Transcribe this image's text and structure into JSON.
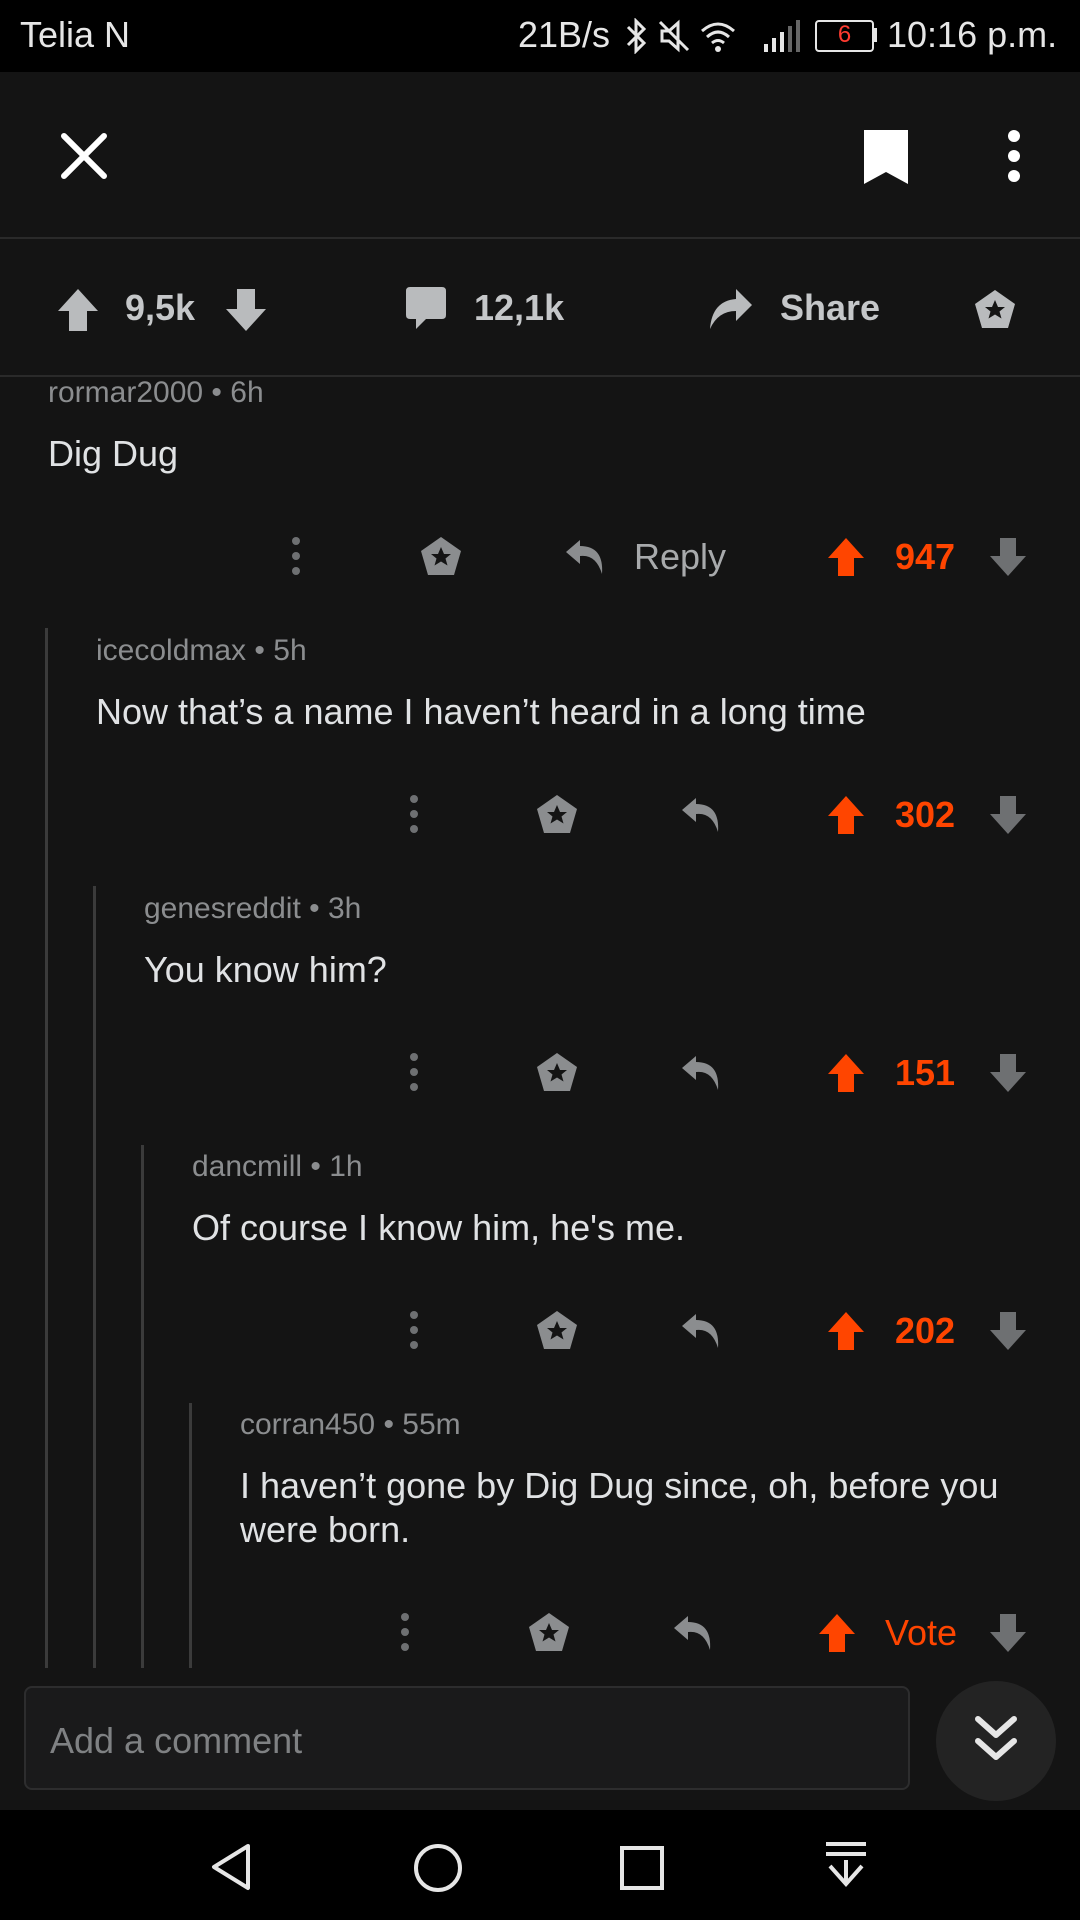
{
  "status_bar": {
    "carrier": "Telia N",
    "net_speed": "21B/s",
    "battery": "6",
    "time": "10:16 p.m."
  },
  "post_actions": {
    "upvotes": "9,5k",
    "comments": "12,1k",
    "share_label": "Share"
  },
  "comments": [
    {
      "author": "rormar2000",
      "age": "6h",
      "text": "Dig Dug",
      "score": "947",
      "reply_label": "Reply"
    },
    {
      "author": "icecoldmax",
      "age": "5h",
      "text": "Now that’s a name I haven’t heard in a long time",
      "score": "302"
    },
    {
      "author": "genesreddit",
      "age": "3h",
      "text": "You know him?",
      "score": "151"
    },
    {
      "author": "dancmill",
      "age": "1h",
      "text": "Of course I know him, he's me.",
      "score": "202"
    },
    {
      "author": "corran450",
      "age": "55m",
      "text_line1": "I haven’t gone by Dig Dug since, oh, before you",
      "text_line2": "were born.",
      "score": "Vote"
    }
  ],
  "comment_input": {
    "placeholder": "Add a comment"
  },
  "meta_separator": "•",
  "colors": {
    "upvote": "#ff4500",
    "background": "#141414",
    "muted": "#8b8d8f"
  },
  "icons": [
    "close-icon",
    "bookmark-icon",
    "more-vertical-icon",
    "upvote-icon",
    "downvote-icon",
    "comment-icon",
    "share-icon",
    "award-icon",
    "reply-icon",
    "scroll-down-icon",
    "back-icon",
    "home-icon",
    "recents-icon",
    "notification-icon"
  ]
}
